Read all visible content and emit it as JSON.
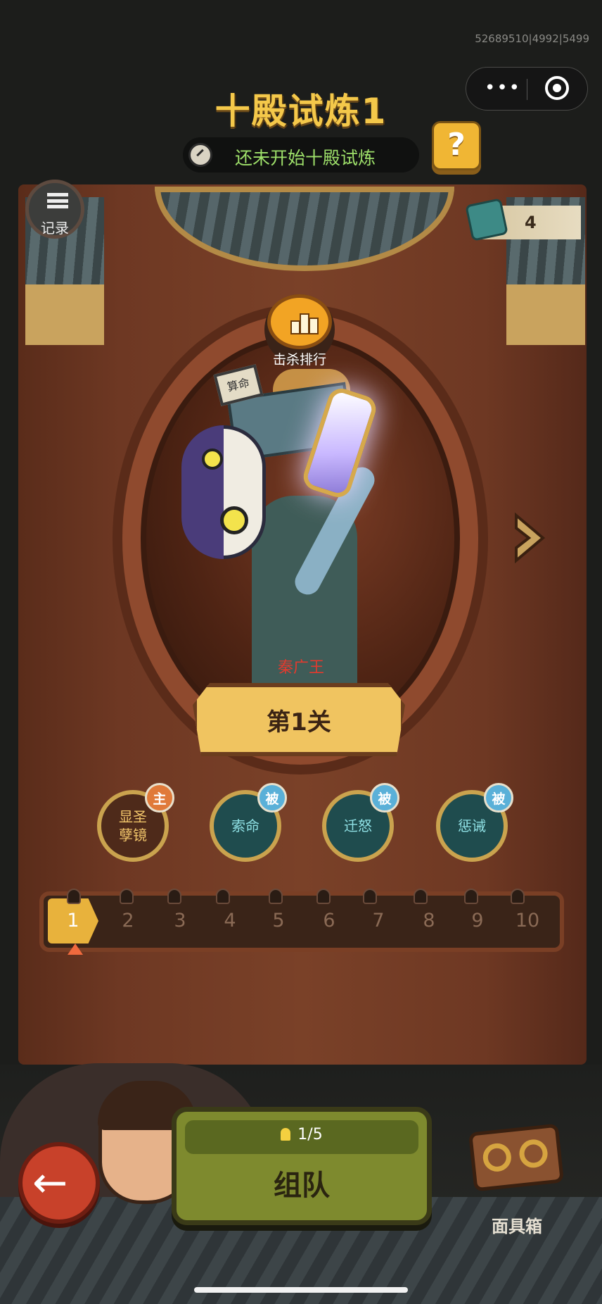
{
  "debug_ids": "52689510|4992|5499",
  "header": {
    "title": "十殿试炼1",
    "status_text": "还未开始十殿试炼",
    "help_label": "?"
  },
  "record_label": "记录",
  "gem_count": "4",
  "rank_label": "击杀排行",
  "boss": {
    "plaque": "算命",
    "name": "秦广王"
  },
  "stage_label": "第1关",
  "skills": [
    {
      "name": "显圣\n孽镜",
      "tag": "主"
    },
    {
      "name": "索命",
      "tag": "被"
    },
    {
      "name": "迁怒",
      "tag": "被"
    },
    {
      "name": "惩诫",
      "tag": "被"
    }
  ],
  "levels": [
    "1",
    "2",
    "3",
    "4",
    "5",
    "6",
    "7",
    "8",
    "9",
    "10"
  ],
  "current_level": 1,
  "team": {
    "count": "1/5",
    "label": "组队"
  },
  "chest_label": "面具箱",
  "colors": {
    "title": "#f4c84a",
    "status_text": "#9ee06a",
    "boss_name": "#e33a2e",
    "team_button": "#7e8a2e",
    "current_level": "#e8b23c"
  }
}
